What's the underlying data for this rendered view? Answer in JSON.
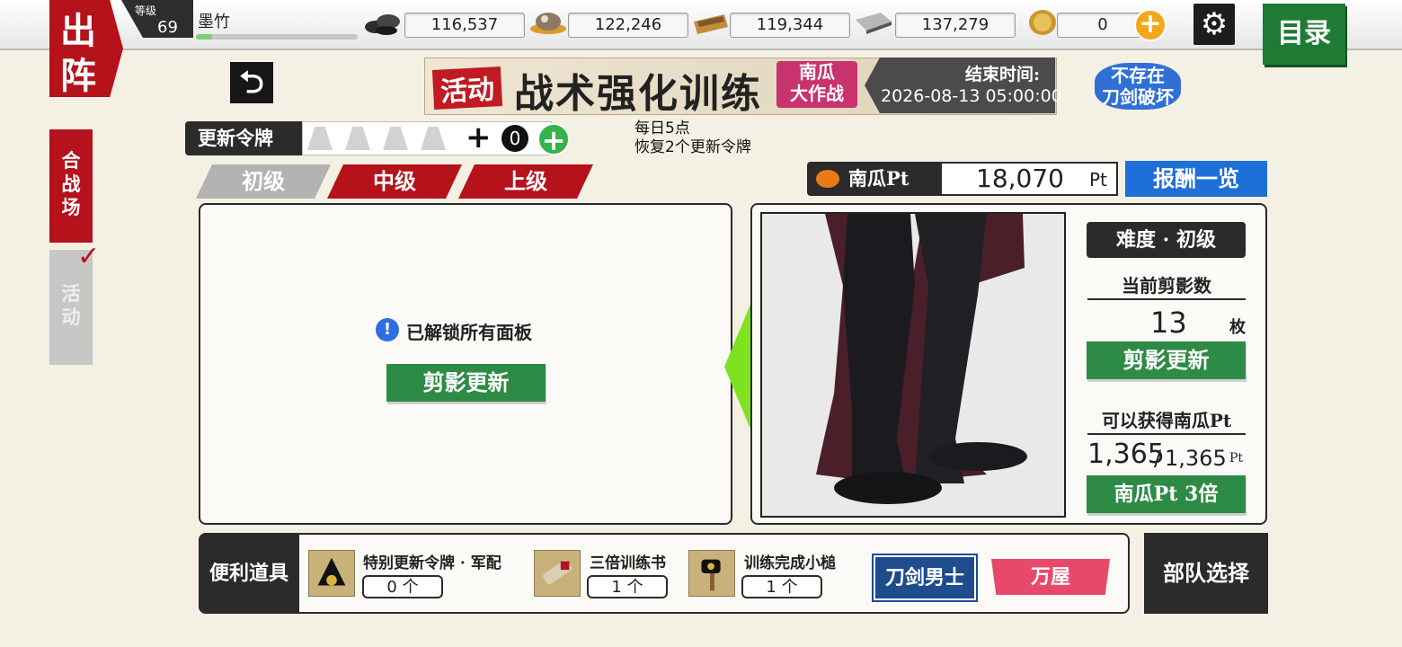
{
  "header": {
    "sortie_label": "出阵",
    "level_label": "等级",
    "level_value": "69",
    "player_name": "墨竹",
    "exp_fraction": 0.1,
    "resources": [
      {
        "icon": "charcoal-icon",
        "value": "116,537"
      },
      {
        "icon": "cooling-material-icon",
        "value": "122,246"
      },
      {
        "icon": "whetstone-icon",
        "value": "119,344"
      },
      {
        "icon": "steel-icon",
        "value": "137,279"
      }
    ],
    "koban": {
      "icon": "koban-coin-icon",
      "value": "0",
      "add_icon": "plus-icon"
    },
    "settings_icon": "gear-icon",
    "menu_label": "目录"
  },
  "side_tabs": {
    "combat": "合战场",
    "event": "活动"
  },
  "event_banner": {
    "tag": "活动",
    "title": "战术强化训练",
    "subtitle_line1": "南瓜",
    "subtitle_line2": "大作战",
    "end_label": "结束时间:",
    "end_date": "2026-08-13 05:00:00",
    "no_break_line1": "不存在",
    "no_break_line2": "刀剑破坏"
  },
  "tokens": {
    "label": "更新令牌",
    "count": "0",
    "daily_line1": "每日5点",
    "daily_line2": "恢复2个更新令牌"
  },
  "difficulty_tabs": [
    "初级",
    "中级",
    "上级"
  ],
  "points": {
    "label": "南瓜Pt",
    "value": "18,070",
    "unit": "Pt",
    "rewards_button": "报酬一览"
  },
  "left_panel": {
    "unlocked_text": "已解锁所有面板",
    "refresh_button": "剪影更新"
  },
  "right_panel": {
    "difficulty_label": "难度 · 初级",
    "silhouette_count_label": "当前剪影数",
    "silhouette_count": "13",
    "silhouette_unit": "枚",
    "refresh_button": "剪影更新",
    "earnable_label": "可以获得南瓜Pt",
    "earnable_current": "1,365",
    "earnable_separator": "/",
    "earnable_max": "1,365",
    "earnable_unit": "Pt",
    "triple_button": "南瓜Pt 3倍"
  },
  "bottom": {
    "tools_label": "便利道具",
    "items": [
      {
        "name": "特别更新令牌 · 军配",
        "qty": "0 个",
        "icon": "war-fan-icon"
      },
      {
        "name": "三倍训练书",
        "qty": "1 个",
        "icon": "scroll-icon"
      },
      {
        "name": "训练完成小槌",
        "qty": "1 个",
        "icon": "mallet-icon"
      }
    ],
    "swords_button": "刀剑男士",
    "shop_button": "万屋",
    "squad_button": "部队选择"
  },
  "colors": {
    "accent_red": "#b5121b",
    "accent_green": "#2e8b45",
    "accent_blue": "#1f6fd9",
    "background": "#f4f0e3"
  }
}
